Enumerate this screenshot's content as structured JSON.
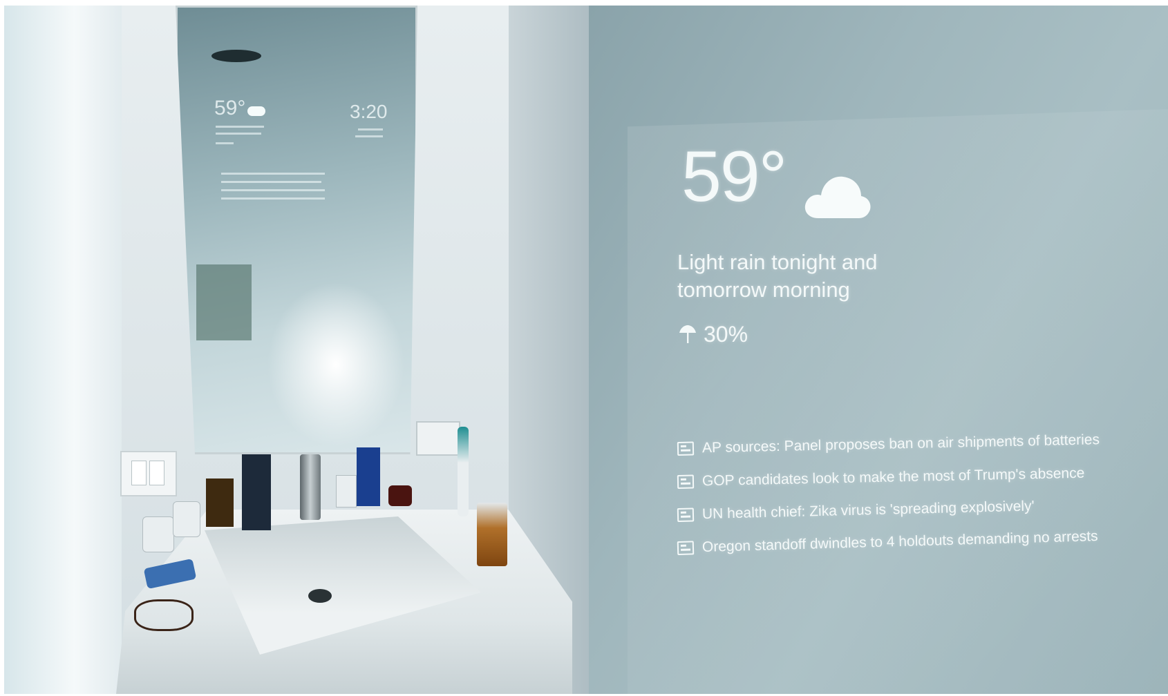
{
  "mirror_reflection": {
    "temperature": "59°",
    "time": "3:20"
  },
  "smart_mirror": {
    "temperature": "59°",
    "weather_icon": "cloud-icon",
    "forecast": "Light rain tonight and tomorrow morning",
    "precipitation_icon": "umbrella-icon",
    "precipitation": "30%",
    "news": [
      {
        "icon": "news-icon",
        "headline": "AP sources: Panel proposes ban on air shipments of batteries"
      },
      {
        "icon": "news-icon",
        "headline": "GOP candidates look to make the most of Trump's absence"
      },
      {
        "icon": "news-icon",
        "headline": "UN health chief: Zika virus is 'spreading explosively'"
      },
      {
        "icon": "news-icon",
        "headline": "Oregon standoff dwindles to 4 holdouts demanding no arrests"
      }
    ]
  },
  "colors": {
    "wall_tint": "#9fb6bc",
    "overlay_text": "#f4f9f9"
  }
}
